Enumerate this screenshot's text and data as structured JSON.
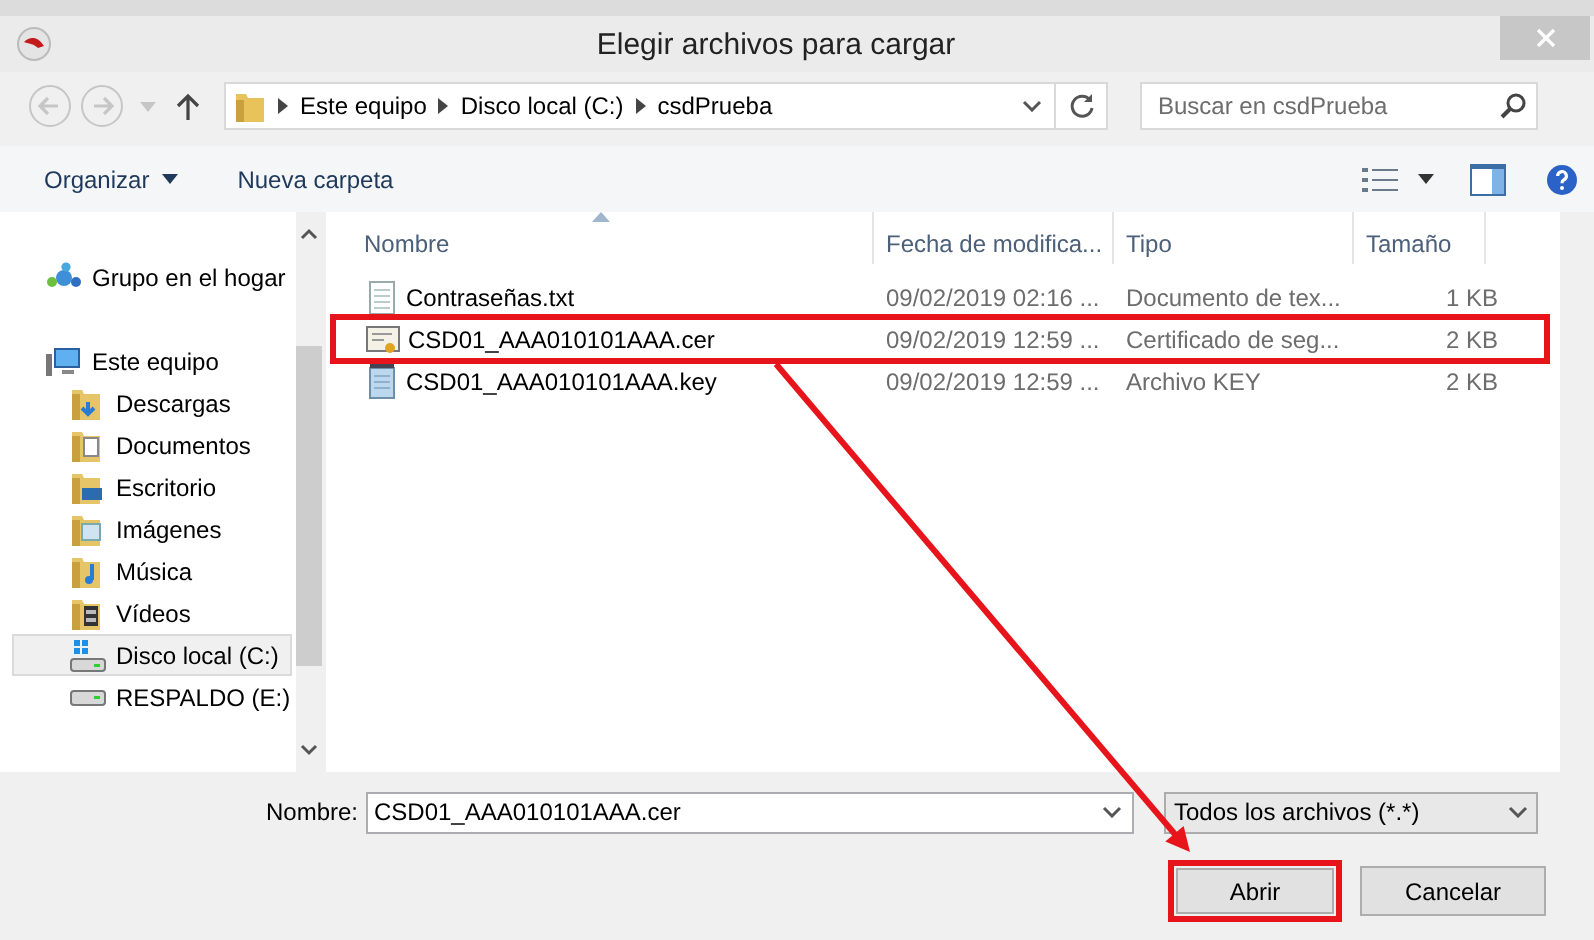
{
  "window": {
    "title": "Elegir archivos para cargar"
  },
  "address_bar": {
    "crumbs": [
      "Este equipo",
      "Disco local (C:)",
      "csdPrueba"
    ]
  },
  "search": {
    "placeholder": "Buscar en csdPrueba"
  },
  "toolbar": {
    "items": [
      {
        "label": "Organizar",
        "kind": "menu"
      },
      {
        "label": "Nueva carpeta",
        "kind": "button"
      }
    ]
  },
  "sidebar": {
    "items": [
      {
        "label": "Grupo en el hogar",
        "kind": "homegroup",
        "selected": false
      },
      {
        "label": "Este equipo",
        "kind": "computer",
        "selected": false,
        "children": [
          {
            "label": "Descargas",
            "kind": "downloads",
            "selected": false
          },
          {
            "label": "Documentos",
            "kind": "documents",
            "selected": false
          },
          {
            "label": "Escritorio",
            "kind": "desktop",
            "selected": false
          },
          {
            "label": "Imágenes",
            "kind": "pictures",
            "selected": false
          },
          {
            "label": "Música",
            "kind": "music",
            "selected": false
          },
          {
            "label": "Vídeos",
            "kind": "videos",
            "selected": false
          },
          {
            "label": "Disco local (C:)",
            "kind": "system-drive",
            "selected": true
          },
          {
            "label": "RESPALDO (E:)",
            "kind": "drive",
            "selected": false
          }
        ]
      }
    ]
  },
  "table": {
    "columns": [
      {
        "label": "Nombre",
        "sorted": true
      },
      {
        "label": "Fecha de modifica...",
        "sorted": false
      },
      {
        "label": "Tipo",
        "sorted": false
      },
      {
        "label": "Tamaño",
        "sorted": false
      }
    ],
    "rows": [
      {
        "kind": "text",
        "name": "Contraseñas.txt",
        "modified": "09/02/2019 02:16 ...",
        "type": "Documento de tex...",
        "size": "1 KB",
        "highlighted": false
      },
      {
        "kind": "certificate",
        "name": "CSD01_AAA010101AAA.cer",
        "modified": "09/02/2019 12:59 ...",
        "type": "Certificado de seg...",
        "size": "2 KB",
        "highlighted": true
      },
      {
        "kind": "key",
        "name": "CSD01_AAA010101AAA.key",
        "modified": "09/02/2019 12:59 ...",
        "type": "Archivo KEY",
        "size": "2 KB",
        "highlighted": false
      }
    ]
  },
  "file_name": {
    "label": "Nombre:",
    "value": "CSD01_AAA010101AAA.cer"
  },
  "file_type": {
    "value": "Todos los archivos (*.*)"
  },
  "buttons": [
    {
      "label": "Abrir",
      "highlighted": true
    },
    {
      "label": "Cancelar",
      "highlighted": false
    }
  ]
}
